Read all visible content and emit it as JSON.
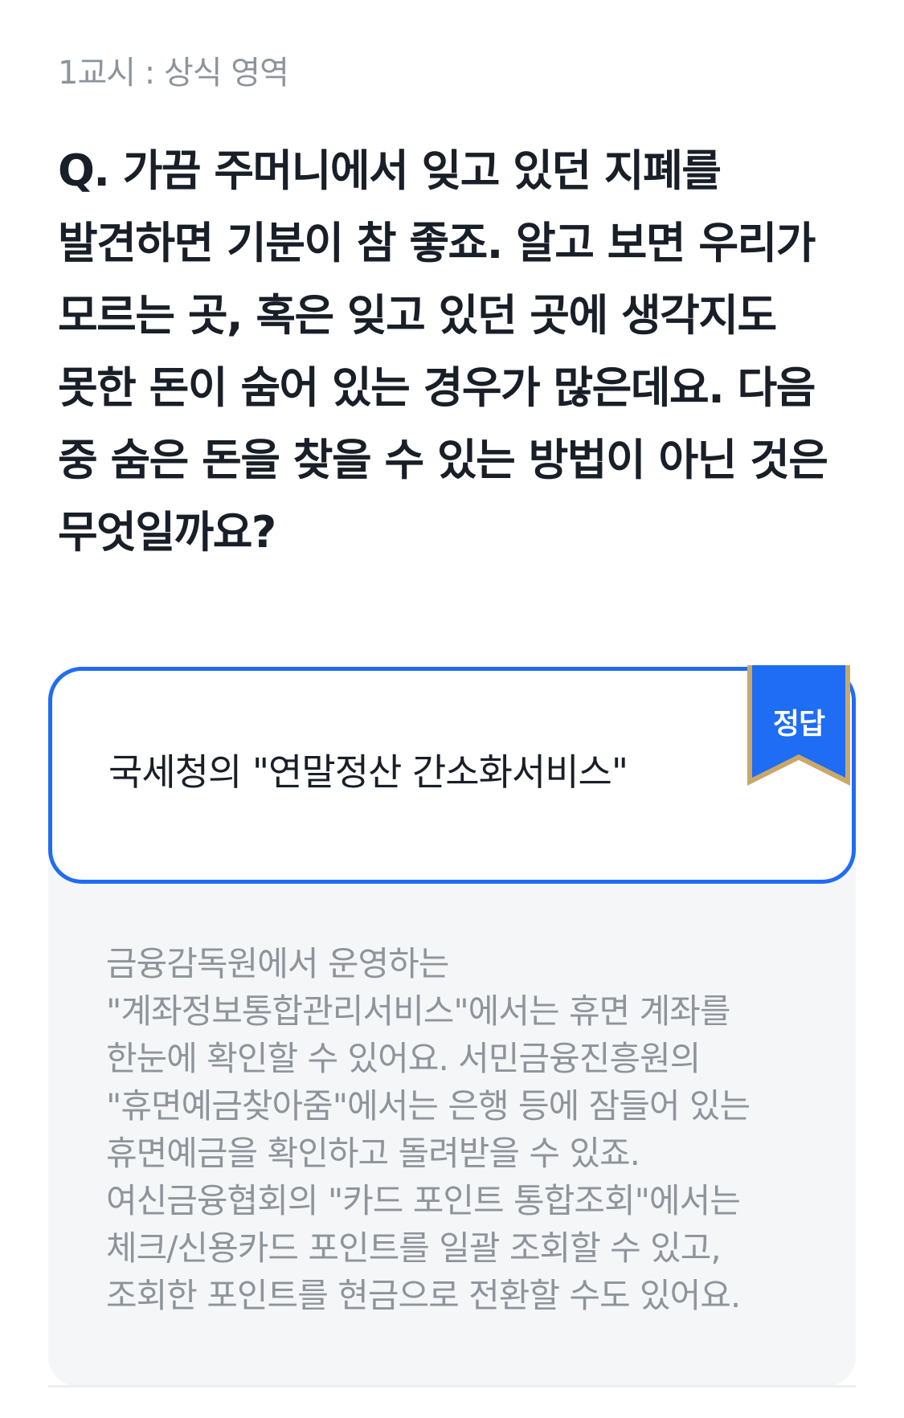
{
  "header": {
    "category": "1교시 : 상식 영역"
  },
  "question": {
    "text": "Q. 가끔 주머니에서 잊고 있던 지폐를 발견하면 기분이 참 좋죠. 알고 보면 우리가 모르는 곳, 혹은 잊고 있던 곳에 생각지도 못한 돈이 숨어 있는 경우가 많은데요. 다음 중 숨은 돈을 찾을 수 있는 방법이 아닌 것은 무엇일까요?"
  },
  "answer": {
    "badge": "정답",
    "text": "국세청의 \"연말정산 간소화서비스\""
  },
  "explanation": {
    "text": "금융감독원에서 운영하는 \"계좌정보통합관리서비스\"에서는 휴면 계좌를 한눈에 확인할 수 있어요. 서민금융진흥원의 \"휴면예금찾아줌\"에서는 은행 등에 잠들어 있는 휴면예금을 확인하고 돌려받을 수 있죠. 여신금융협회의 \"카드 포인트 통합조회\"에서는 체크/신용카드 포인트를 일괄 조회할 수 있고, 조회한 포인트를 현금으로 전환할 수도 있어요."
  },
  "colors": {
    "accent": "#1f6cf5",
    "ribbon_trim": "#c9a86a",
    "question_text": "#191f28",
    "muted_text": "#8e949b",
    "panel_bg": "#f5f6f8"
  }
}
